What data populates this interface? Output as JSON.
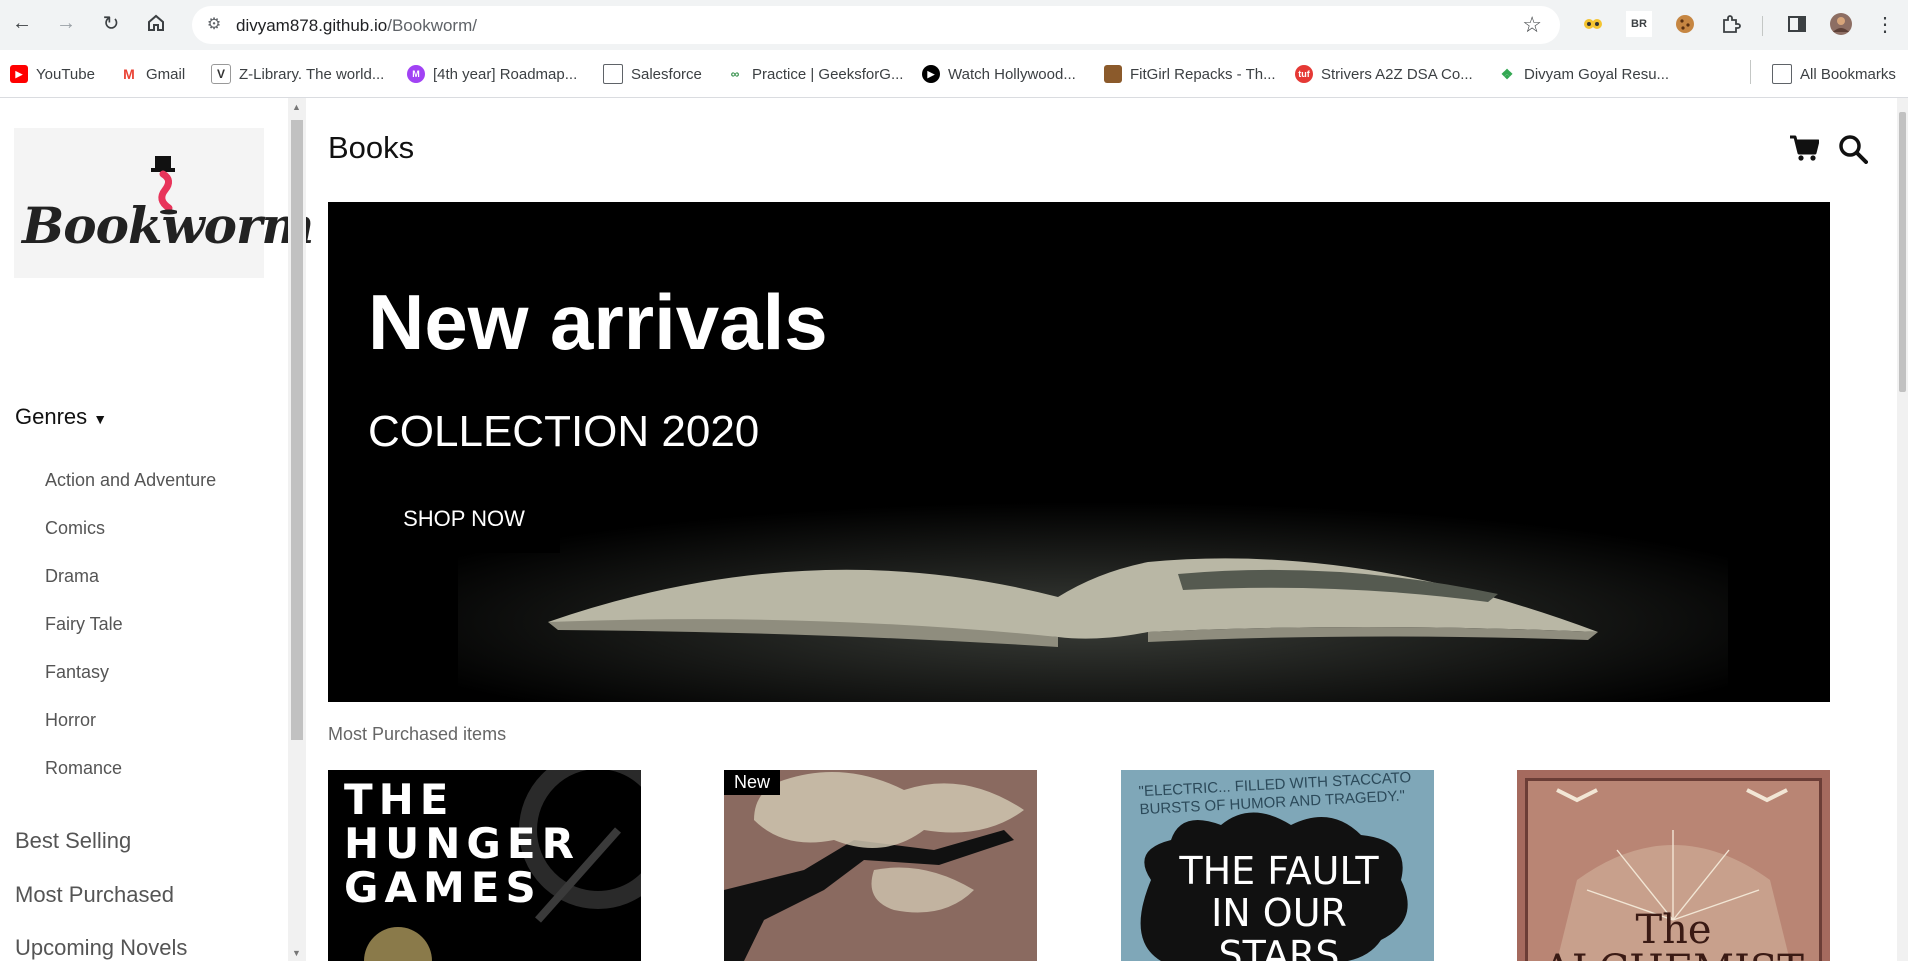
{
  "browser": {
    "url_host": "divyam878.github.io",
    "url_path": "/Bookworm/",
    "bookmarks": [
      {
        "label": "YouTube",
        "color": "#ff0000"
      },
      {
        "label": "Gmail",
        "color": "#ea4335"
      },
      {
        "label": "Z-Library. The world...",
        "color": "#333333"
      },
      {
        "label": "[4th year] Roadmap...",
        "color": "#a142f4"
      },
      {
        "label": "Salesforce",
        "color": "#5f6368"
      },
      {
        "label": "Practice | GeeksforG...",
        "color": "#2f8d46"
      },
      {
        "label": "Watch Hollywood...",
        "color": "#000000"
      },
      {
        "label": "FitGirl Repacks - Th...",
        "color": "#8b5a2b"
      },
      {
        "label": "Strivers A2Z DSA Co...",
        "color": "#e53935"
      },
      {
        "label": "Divyam Goyal Resu...",
        "color": "#34a853"
      }
    ],
    "all_bookmarks_label": "All Bookmarks",
    "extension_badge": "BR"
  },
  "sidebar": {
    "logo_text": "Bookworm",
    "genres_label": "Genres",
    "genres": [
      "Action and Adventure",
      "Comics",
      "Drama",
      "Fairy Tale",
      "Fantasy",
      "Horror",
      "Romance"
    ],
    "links": [
      "Best Selling",
      "Most Purchased",
      "Upcoming Novels"
    ]
  },
  "main": {
    "title": "Books",
    "banner": {
      "heading": "New arrivals",
      "subheading": "COLLECTION 2020",
      "button": "SHOP NOW"
    },
    "section_title": "Most Purchased items",
    "books": [
      {
        "cover_text": "THE HUNGER GAMES",
        "badge": "",
        "bg": "#000000"
      },
      {
        "cover_text": "",
        "badge": "New",
        "bg": "#8a6a60"
      },
      {
        "cover_text": "THE FAULT IN OUR STARS",
        "quote": "\"ELECTRIC... FILLED WITH STACCATO BURSTS OF HUMOR AND TRAGEDY.\"",
        "badge": "",
        "bg": "#7fa7b8"
      },
      {
        "cover_text": "The ALCHEMIST",
        "badge": "",
        "bg": "#a56a5e"
      }
    ]
  }
}
